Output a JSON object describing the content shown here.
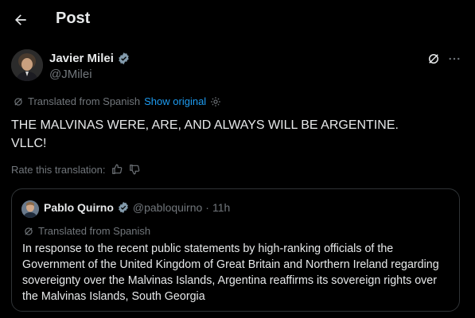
{
  "header": {
    "title": "Post"
  },
  "author": {
    "name": "Javier Milei",
    "handle": "@JMilei"
  },
  "translation": {
    "label": "Translated from Spanish",
    "show_original": "Show original"
  },
  "post": {
    "text": "THE MALVINAS WERE, ARE, AND ALWAYS WILL BE ARGENTINE.\nVLLC!"
  },
  "rate": {
    "label": "Rate this translation:"
  },
  "quote": {
    "name": "Pablo Quirno",
    "handle": "@pabloquirno",
    "separator": "·",
    "time": "11h",
    "translated_label": "Translated from Spanish",
    "text": "In response to the recent public statements by high-ranking officials of the Government of the United Kingdom of Great Britain and Northern Ireland regarding sovereignty over the Malvinas Islands, Argentina reaffirms its sovereign rights over the Malvinas Islands, South Georgia"
  },
  "colors": {
    "background": "#000000",
    "text": "#e7e9ea",
    "muted": "#71767b",
    "link": "#1d9bf0",
    "verified": "#829aab",
    "border": "#2f3336"
  }
}
